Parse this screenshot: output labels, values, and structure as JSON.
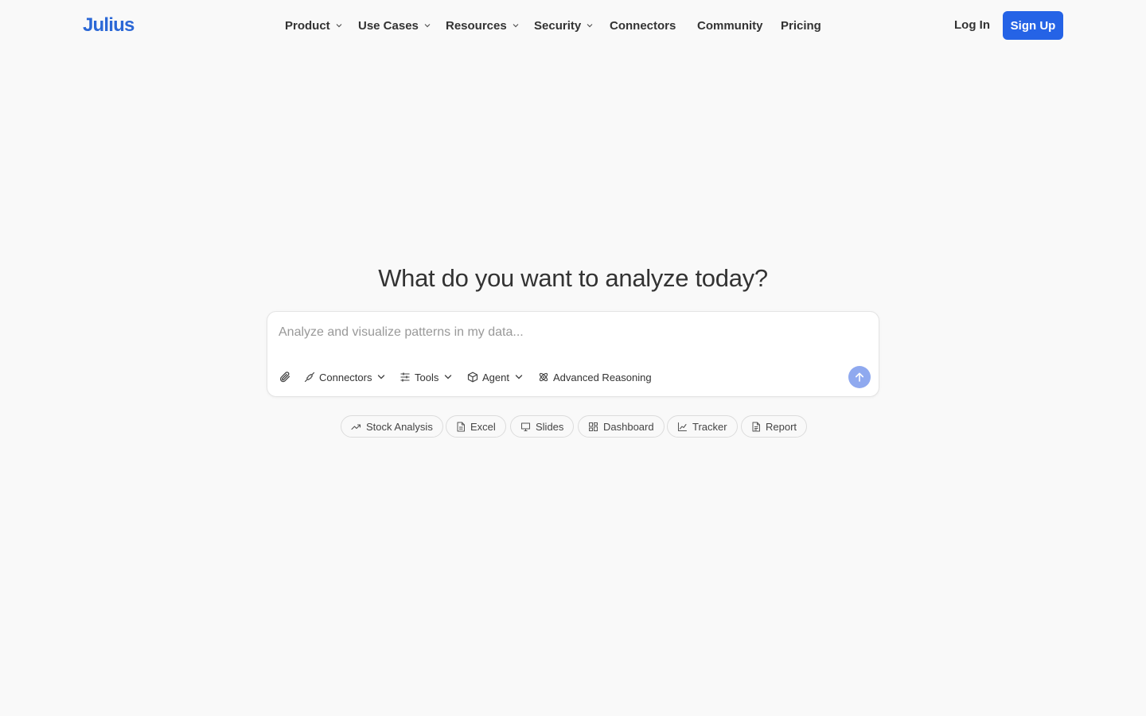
{
  "brand": {
    "logo_text": "Julius",
    "accent_color": "#2563e6",
    "logo_color": "#2a67d6"
  },
  "nav": {
    "items": [
      {
        "label": "Product",
        "has_dropdown": true
      },
      {
        "label": "Use Cases",
        "has_dropdown": true
      },
      {
        "label": "Resources",
        "has_dropdown": true
      },
      {
        "label": "Security",
        "has_dropdown": true
      },
      {
        "label": "Connectors",
        "has_dropdown": false
      },
      {
        "label": "Community",
        "has_dropdown": false
      },
      {
        "label": "Pricing",
        "has_dropdown": false
      }
    ],
    "login_label": "Log In",
    "signup_label": "Sign Up"
  },
  "hero": {
    "headline": "What do you want to analyze today?"
  },
  "composer": {
    "placeholder": "Analyze and visualize patterns in my data...",
    "value": "",
    "attach_icon": "paperclip-icon",
    "tools": [
      {
        "label": "Connectors",
        "icon": "plug-icon",
        "has_dropdown": true
      },
      {
        "label": "Tools",
        "icon": "sliders-icon",
        "has_dropdown": true
      },
      {
        "label": "Agent",
        "icon": "cube-icon",
        "has_dropdown": true
      },
      {
        "label": "Advanced Reasoning",
        "icon": "atom-icon",
        "has_dropdown": false
      }
    ],
    "send_icon": "arrow-up-icon",
    "send_color": "#8fa9ef"
  },
  "suggestions": [
    {
      "label": "Stock Analysis",
      "icon": "trending-up-icon"
    },
    {
      "label": "Excel",
      "icon": "file-icon"
    },
    {
      "label": "Slides",
      "icon": "presentation-icon"
    },
    {
      "label": "Dashboard",
      "icon": "grid-icon"
    },
    {
      "label": "Tracker",
      "icon": "line-chart-icon"
    },
    {
      "label": "Report",
      "icon": "document-icon"
    }
  ]
}
